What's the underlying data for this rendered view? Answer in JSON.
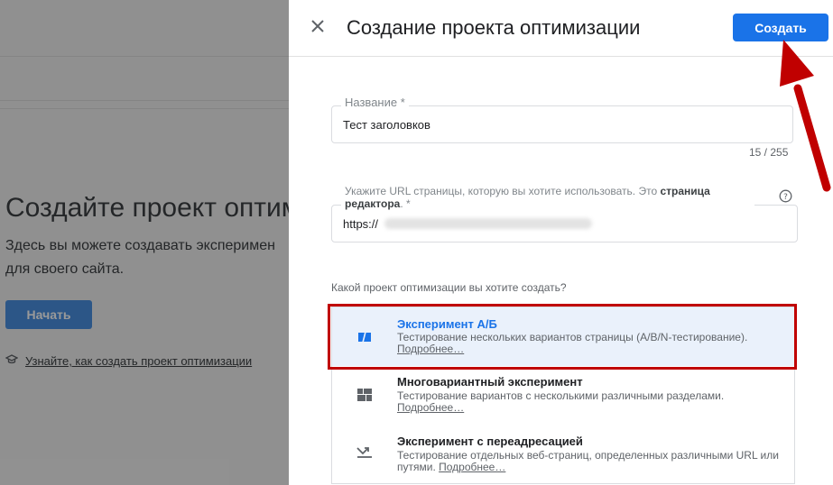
{
  "background": {
    "title": "Создайте проект оптим",
    "description_line1": "Здесь вы можете создавать эксперимен",
    "description_line2": "для своего сайта.",
    "start_button": "Начать",
    "learn_link": "Узнайте, как создать проект оптимизации"
  },
  "panel": {
    "title": "Создание проекта оптимизации",
    "create_button": "Создать",
    "name_field": {
      "label": "Название *",
      "value": "Тест заголовков",
      "counter": "15 / 255"
    },
    "url_field": {
      "label_prefix": "Укажите URL страницы, которую вы хотите использовать. Это",
      "label_bold": "страница редактора",
      "label_suffix": ". *",
      "value_prefix": "https://"
    },
    "question": "Какой проект оптимизации вы хотите создать?",
    "options": [
      {
        "title": "Эксперимент А/Б",
        "description": "Тестирование нескольких вариантов страницы (A/B/N-тестирование).",
        "more": "Подробнее…",
        "icon": "ab-test-icon",
        "selected": true
      },
      {
        "title": "Многовариантный эксперимент",
        "description": "Тестирование вариантов с несколькими различными разделами.",
        "more": "Подробнее…",
        "icon": "multivariate-icon",
        "selected": false
      },
      {
        "title": "Эксперимент с переадресацией",
        "description": "Тестирование отдельных веб-страниц, определенных различными URL или путями.",
        "more": "Подробнее…",
        "icon": "redirect-icon",
        "selected": false
      }
    ]
  },
  "colors": {
    "accent": "#1a73e8",
    "highlight": "#c00000",
    "selected_bg": "#eaf1fb"
  }
}
